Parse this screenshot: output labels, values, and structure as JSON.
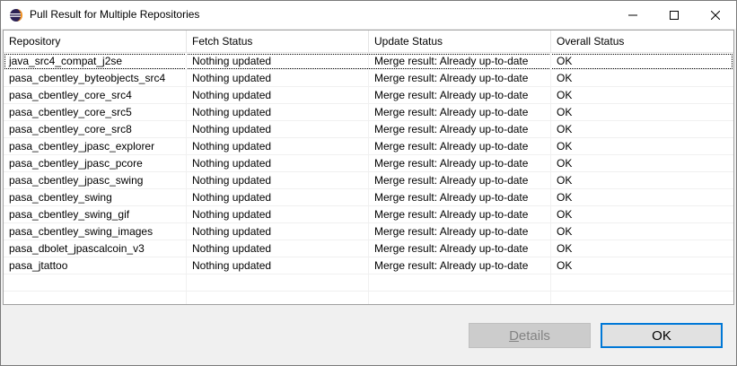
{
  "window": {
    "title": "Pull Result for Multiple Repositories",
    "icon": "eclipse-icon",
    "controls": [
      "minimize-icon",
      "maximize-icon",
      "close-icon"
    ]
  },
  "table": {
    "columns": [
      "Repository",
      "Fetch Status",
      "Update Status",
      "Overall Status"
    ],
    "rows": [
      [
        "java_src4_compat_j2se",
        "Nothing updated",
        "Merge result: Already up-to-date",
        "OK"
      ],
      [
        "pasa_cbentley_byteobjects_src4",
        "Nothing updated",
        "Merge result: Already up-to-date",
        "OK"
      ],
      [
        "pasa_cbentley_core_src4",
        "Nothing updated",
        "Merge result: Already up-to-date",
        "OK"
      ],
      [
        "pasa_cbentley_core_src5",
        "Nothing updated",
        "Merge result: Already up-to-date",
        "OK"
      ],
      [
        "pasa_cbentley_core_src8",
        "Nothing updated",
        "Merge result: Already up-to-date",
        "OK"
      ],
      [
        "pasa_cbentley_jpasc_explorer",
        "Nothing updated",
        "Merge result: Already up-to-date",
        "OK"
      ],
      [
        "pasa_cbentley_jpasc_pcore",
        "Nothing updated",
        "Merge result: Already up-to-date",
        "OK"
      ],
      [
        "pasa_cbentley_jpasc_swing",
        "Nothing updated",
        "Merge result: Already up-to-date",
        "OK"
      ],
      [
        "pasa_cbentley_swing",
        "Nothing updated",
        "Merge result: Already up-to-date",
        "OK"
      ],
      [
        "pasa_cbentley_swing_gif",
        "Nothing updated",
        "Merge result: Already up-to-date",
        "OK"
      ],
      [
        "pasa_cbentley_swing_images",
        "Nothing updated",
        "Merge result: Already up-to-date",
        "OK"
      ],
      [
        "pasa_dbolet_jpascalcoin_v3",
        "Nothing updated",
        "Merge result: Already up-to-date",
        "OK"
      ],
      [
        "pasa_jtattoo",
        "Nothing updated",
        "Merge result: Already up-to-date",
        "OK"
      ]
    ],
    "empty_rows": 2
  },
  "buttons": {
    "details_first": "D",
    "details_rest": "etails",
    "ok": "OK"
  },
  "colors": {
    "focus_border": "#0078d7",
    "disabled_text": "#838383"
  }
}
